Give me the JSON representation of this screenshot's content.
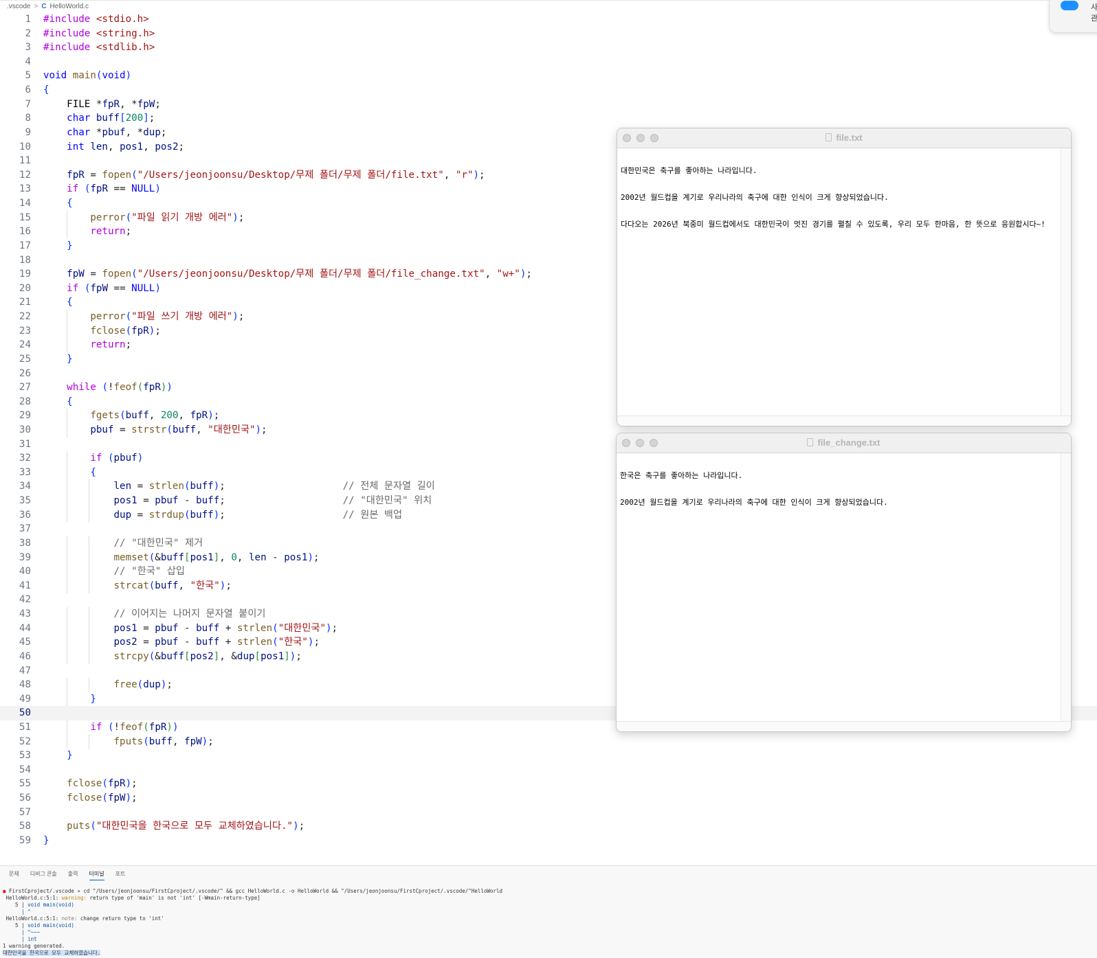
{
  "breadcrumb": {
    "folder": ".vscode",
    "separator": ">",
    "file_icon": "C",
    "file": "HelloWorld.c"
  },
  "editor": {
    "current_line": 50,
    "lines": [
      "#include <stdio.h>",
      "#include <string.h>",
      "#include <stdlib.h>",
      "",
      "void main(void)",
      "{",
      "    FILE *fpR, *fpW;",
      "    char buff[200];",
      "    char *pbuf, *dup;",
      "    int len, pos1, pos2;",
      "",
      "    fpR = fopen(\"/Users/jeonjoonsu/Desktop/무제 폴더/무제 폴더/file.txt\", \"r\");",
      "    if (fpR == NULL)",
      "    {",
      "        perror(\"파일 읽기 개방 에러\");",
      "        return;",
      "    }",
      "",
      "    fpW = fopen(\"/Users/jeonjoonsu/Desktop/무제 폴더/무제 폴더/file_change.txt\", \"w+\");",
      "    if (fpW == NULL)",
      "    {",
      "        perror(\"파일 쓰기 개방 에러\");",
      "        fclose(fpR);",
      "        return;",
      "    }",
      "",
      "    while (!feof(fpR))",
      "    {",
      "        fgets(buff, 200, fpR);",
      "        pbuf = strstr(buff, \"대한민국\");",
      "",
      "        if (pbuf)",
      "        {",
      "            len = strlen(buff);                    // 전체 문자열 길이",
      "            pos1 = pbuf - buff;                    // \"대한민국\" 위치",
      "            dup = strdup(buff);                    // 원본 백업",
      "",
      "            // \"대한민국\" 제거",
      "            memset(&buff[pos1], 0, len - pos1);",
      "            // \"한국\" 삽입",
      "            strcat(buff, \"한국\");",
      "",
      "            // 이어지는 나머지 문자열 붙이기",
      "            pos1 = pbuf - buff + strlen(\"대한민국\");",
      "            pos2 = pbuf - buff + strlen(\"한국\");",
      "            strcpy(&buff[pos2], &dup[pos1]);",
      "",
      "            free(dup);",
      "        }",
      "",
      "        if (!feof(fpR))",
      "            fputs(buff, fpW);",
      "    }",
      "",
      "    fclose(fpR);",
      "    fclose(fpW);",
      "",
      "    puts(\"대한민국을 한국으로 모두 교체하였습니다.\");",
      "}"
    ]
  },
  "windows": [
    {
      "title": "file.txt",
      "lines": [
        "대한민국은 축구를 좋아하는 나라입니다.",
        "2002년 월드컵을 계기로 우리나라의 축구에 대한 인식이 크게 향상되었습니다.",
        "다다오는 2026년 북중미 월드컵에서도 대한민국이 멋진 경기를 펼칠 수 있도록, 우리 모두 한마음, 한 뜻으로 응원합시다~!"
      ]
    },
    {
      "title": "file_change.txt",
      "lines": [
        "한국은 축구를 좋아하는 나라입니다.",
        "2002년 월드컵을 계기로 우리나라의 축구에 대한 인식이 크게 향상되었습니다."
      ]
    }
  ],
  "panel": {
    "tabs": [
      "문제",
      "디버그 콘솔",
      "출력",
      "터미널",
      "포트"
    ],
    "active_tab": "터미널"
  },
  "terminal": {
    "prompt_dot": "●",
    "command": "FirstCproject/.vscode » cd \"/Users/jeonjoonsu/FirstCproject/.vscode/\" && gcc HelloWorld.c -o HelloWorld && \"/Users/jeonjoonsu/FirstCproject/.vscode/\"HelloWorld",
    "warn_loc": "HelloWorld.c:5:1: ",
    "warn_label": "warning: ",
    "warn_msg": "return type of 'main' is not 'int' [-Wmain-return-type]",
    "code_line_prefix": "    5 | ",
    "code_line_code": "void main(void)",
    "caret_line": "      | ^",
    "note_loc": "HelloWorld.c:5:1: ",
    "note_label": "note: ",
    "note_msg": "change return type to 'int'",
    "code_line2_prefix": "    5 | ",
    "code_line2_code": "void main(void)",
    "tilde_line": "      | ^~~~",
    "int_line": "      | int",
    "summary": "1 warning generated.",
    "output": "대한민국을 한국으로 모두 교체하였습니다."
  },
  "corner_popup": {
    "icon": "cloud-icon",
    "text_line1": "사",
    "text_line2": "관"
  }
}
